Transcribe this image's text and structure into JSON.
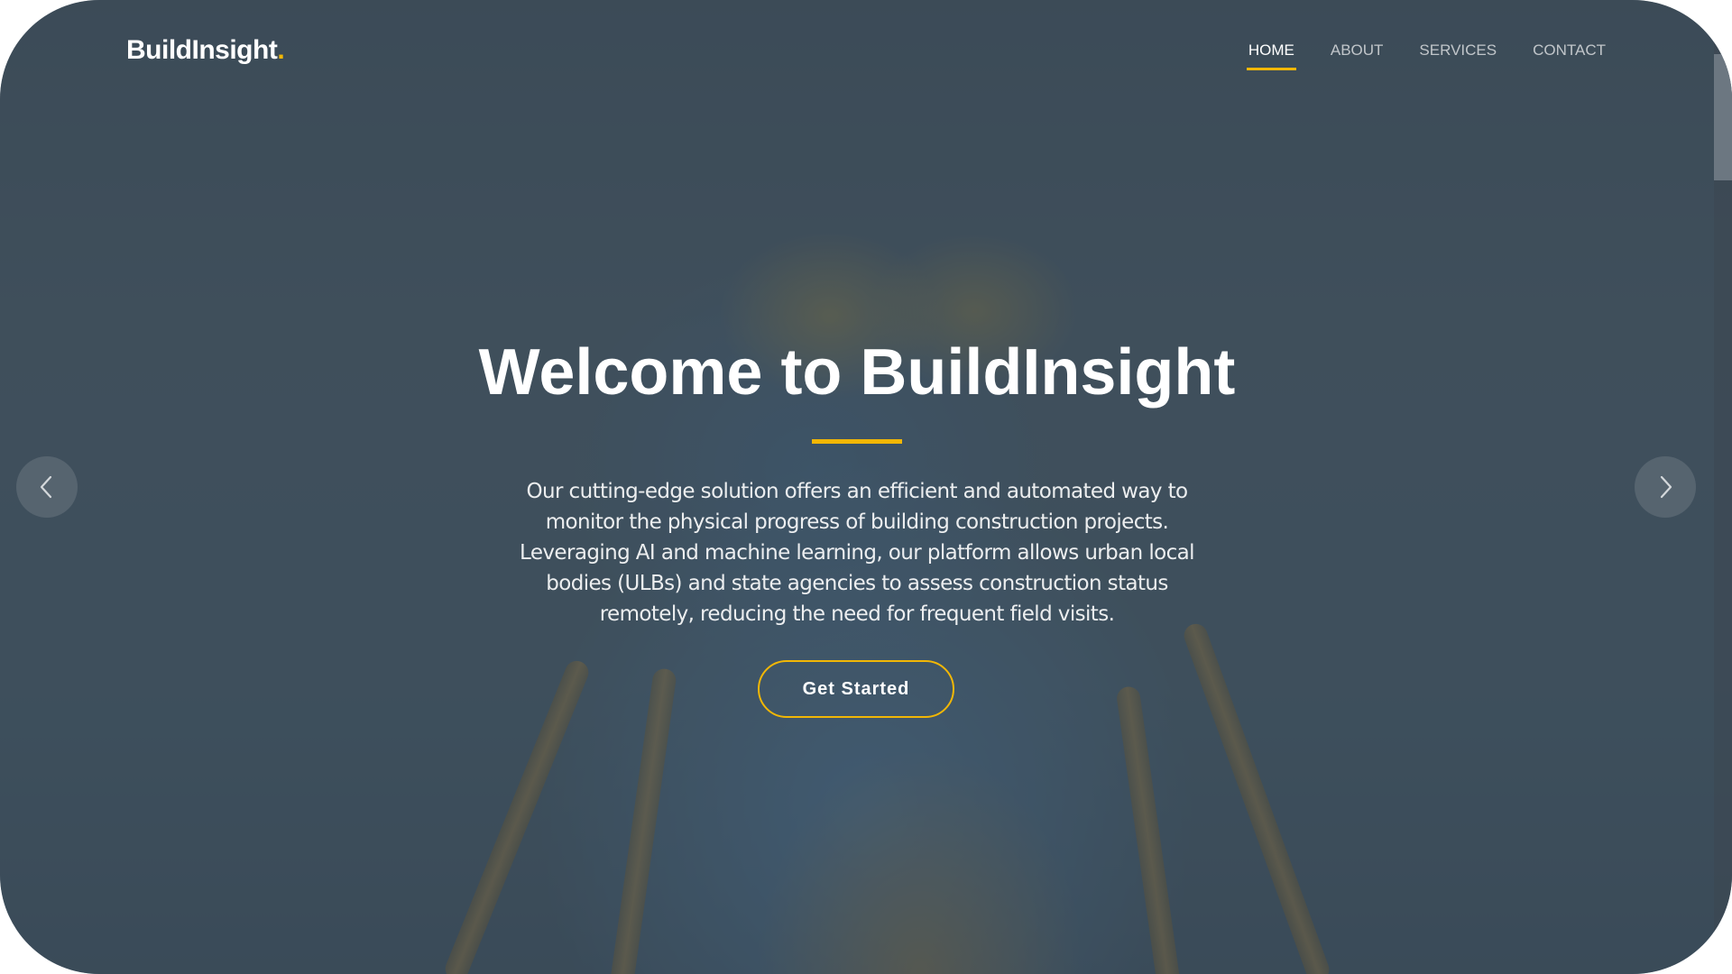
{
  "header": {
    "logo_text": "BuildInsight",
    "logo_dot": ".",
    "nav": [
      {
        "label": "HOME",
        "active": true
      },
      {
        "label": "ABOUT",
        "active": false
      },
      {
        "label": "SERVICES",
        "active": false
      },
      {
        "label": "CONTACT",
        "active": false
      }
    ]
  },
  "hero": {
    "title": "Welcome to BuildInsight",
    "description": "Our cutting-edge solution offers an efficient and automated way to monitor the physical progress of building construction projects. Leveraging AI and machine learning, our platform allows urban local bodies (ULBs) and state agencies to assess construction status remotely, reducing the need for frequent field visits.",
    "cta_label": "Get Started"
  },
  "carousel": {
    "prev_icon": "chevron-left-icon",
    "next_icon": "chevron-right-icon"
  },
  "colors": {
    "accent": "#f2b705",
    "overlay": "#2a3844",
    "text": "#ffffff"
  }
}
